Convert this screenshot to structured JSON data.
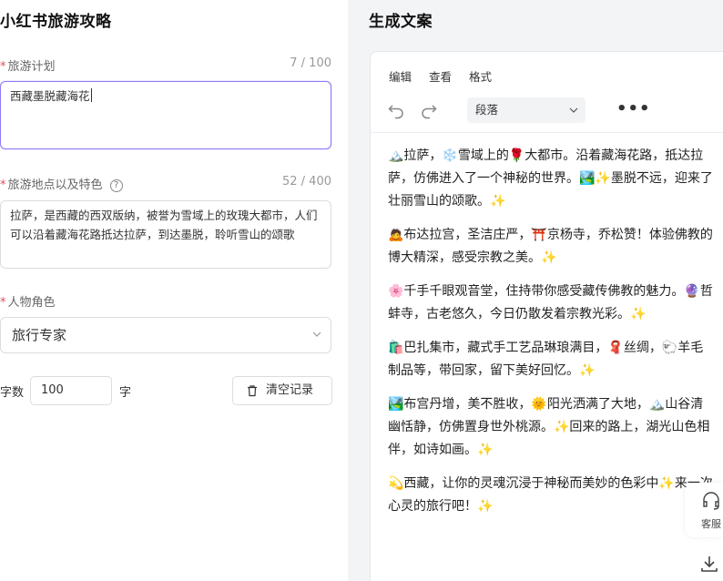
{
  "left": {
    "title": "小红书旅游攻略",
    "plan": {
      "label": "旅游计划",
      "count": "7 / 100",
      "value": "西藏墨脱藏海花"
    },
    "location": {
      "label": "旅游地点以及特色",
      "count": "52 / 400",
      "value": "拉萨，是西藏的西双版纳，被誉为雪域上的玫瑰大都市，人们可以沿着藏海花路抵达拉萨，到达墨脱，聆听雪山的颂歌"
    },
    "role": {
      "label": "人物角色",
      "selected": "旅行专家"
    },
    "word_count": {
      "label": "字数",
      "value": "100",
      "unit": "字"
    },
    "clear_label": "清空记录"
  },
  "right": {
    "title": "生成文案",
    "menu": [
      "编辑",
      "查看",
      "格式"
    ],
    "paragraph_select": "段落",
    "paragraphs": [
      "🏔️拉萨，❄️雪域上的🌹大都市。沿着藏海花路，抵达拉萨，仿佛进入了一个神秘的世界。🏞️✨墨脱不远，迎来了壮丽雪山的颂歌。✨",
      "🙇布达拉宫，圣洁庄严，⛩️京杨寺，乔松赞！体验佛教的博大精深，感受宗教之美。✨",
      "🌸千手千眼观音堂，住持带你感受藏传佛教的魅力。🔮哲蚌寺，古老悠久，今日仍散发着宗教光彩。✨",
      "🛍️巴扎集市，藏式手工艺品琳琅满目，🧣丝绸，🐑羊毛制品等，带回家，留下美好回忆。✨",
      "🏞️布宫丹增，美不胜收，🌞阳光洒满了大地，🏔️山谷清幽恬静，仿佛置身世外桃源。✨回来的路上，湖光山色相伴，如诗如画。✨",
      "💫西藏，让你的灵魂沉浸于神秘而美妙的色彩中✨来一次心灵的旅行吧！✨"
    ]
  },
  "float": {
    "service_label": "客服"
  },
  "colors": {
    "focus_border": "#8b7cf6",
    "required": "#e34d59"
  }
}
